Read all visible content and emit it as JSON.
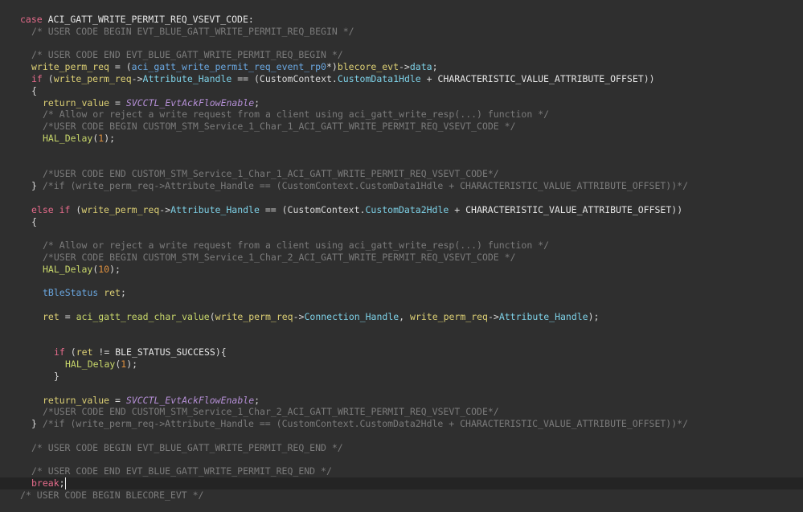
{
  "editor": {
    "lines": [
      {
        "indent": 0,
        "tokens": [
          {
            "t": "kw",
            "v": "case"
          },
          {
            "t": "macro",
            "v": " ACI_GATT_WRITE_PERMIT_REQ_VSEVT_CODE:"
          }
        ]
      },
      {
        "indent": 1,
        "tokens": [
          {
            "t": "cm",
            "v": "/* USER CODE BEGIN EVT_BLUE_GATT_WRITE_PERMIT_REQ_BEGIN */"
          }
        ]
      },
      {
        "indent": 0,
        "tokens": []
      },
      {
        "indent": 1,
        "tokens": [
          {
            "t": "cm",
            "v": "/* USER CODE END EVT_BLUE_GATT_WRITE_PERMIT_REQ_BEGIN */"
          }
        ]
      },
      {
        "indent": 1,
        "tokens": [
          {
            "t": "var",
            "v": "write_perm_req"
          },
          {
            "t": "punc",
            "v": " = ("
          },
          {
            "t": "type",
            "v": "aci_gatt_write_permit_req_event_rp0"
          },
          {
            "t": "punc",
            "v": "*)"
          },
          {
            "t": "var",
            "v": "blecore_evt"
          },
          {
            "t": "punc",
            "v": "->"
          },
          {
            "t": "field",
            "v": "data"
          },
          {
            "t": "punc",
            "v": ";"
          }
        ]
      },
      {
        "indent": 1,
        "tokens": [
          {
            "t": "kw",
            "v": "if"
          },
          {
            "t": "punc",
            "v": " ("
          },
          {
            "t": "var",
            "v": "write_perm_req"
          },
          {
            "t": "punc",
            "v": "->"
          },
          {
            "t": "field",
            "v": "Attribute_Handle"
          },
          {
            "t": "punc",
            "v": " == (CustomContext."
          },
          {
            "t": "field",
            "v": "CustomData1Hdle"
          },
          {
            "t": "punc",
            "v": " + "
          },
          {
            "t": "macro",
            "v": "CHARACTERISTIC_VALUE_ATTRIBUTE_OFFSET"
          },
          {
            "t": "punc",
            "v": "))"
          }
        ]
      },
      {
        "indent": 1,
        "tokens": [
          {
            "t": "punc",
            "v": "{"
          }
        ]
      },
      {
        "indent": 2,
        "tokens": [
          {
            "t": "var",
            "v": "return_value"
          },
          {
            "t": "punc",
            "v": " = "
          },
          {
            "t": "cst",
            "v": "SVCCTL_EvtAckFlowEnable"
          },
          {
            "t": "punc",
            "v": ";"
          }
        ]
      },
      {
        "indent": 2,
        "tokens": [
          {
            "t": "cm",
            "v": "/* Allow or reject a write request from a client using aci_gatt_write_resp(...) function */"
          }
        ]
      },
      {
        "indent": 2,
        "tokens": [
          {
            "t": "cm",
            "v": "/*USER CODE BEGIN CUSTOM_STM_Service_1_Char_1_ACI_GATT_WRITE_PERMIT_REQ_VSEVT_CODE */"
          }
        ]
      },
      {
        "indent": 2,
        "tokens": [
          {
            "t": "fn",
            "v": "HAL_Delay"
          },
          {
            "t": "punc",
            "v": "("
          },
          {
            "t": "num",
            "v": "1"
          },
          {
            "t": "punc",
            "v": ");"
          }
        ]
      },
      {
        "indent": 0,
        "tokens": []
      },
      {
        "indent": 0,
        "tokens": []
      },
      {
        "indent": 2,
        "tokens": [
          {
            "t": "cm",
            "v": "/*USER CODE END CUSTOM_STM_Service_1_Char_1_ACI_GATT_WRITE_PERMIT_REQ_VSEVT_CODE*/"
          }
        ]
      },
      {
        "indent": 1,
        "tokens": [
          {
            "t": "punc",
            "v": "} "
          },
          {
            "t": "cm",
            "v": "/*if (write_perm_req->Attribute_Handle == (CustomContext.CustomData1Hdle + CHARACTERISTIC_VALUE_ATTRIBUTE_OFFSET))*/"
          }
        ]
      },
      {
        "indent": 0,
        "tokens": []
      },
      {
        "indent": 1,
        "tokens": [
          {
            "t": "kw",
            "v": "else if"
          },
          {
            "t": "punc",
            "v": " ("
          },
          {
            "t": "var",
            "v": "write_perm_req"
          },
          {
            "t": "punc",
            "v": "->"
          },
          {
            "t": "field",
            "v": "Attribute_Handle"
          },
          {
            "t": "punc",
            "v": " == (CustomContext."
          },
          {
            "t": "field",
            "v": "CustomData2Hdle"
          },
          {
            "t": "punc",
            "v": " + "
          },
          {
            "t": "macro",
            "v": "CHARACTERISTIC_VALUE_ATTRIBUTE_OFFSET"
          },
          {
            "t": "punc",
            "v": "))"
          }
        ]
      },
      {
        "indent": 1,
        "tokens": [
          {
            "t": "punc",
            "v": "{"
          }
        ]
      },
      {
        "indent": 0,
        "tokens": []
      },
      {
        "indent": 2,
        "tokens": [
          {
            "t": "cm",
            "v": "/* Allow or reject a write request from a client using aci_gatt_write_resp(...) function */"
          }
        ]
      },
      {
        "indent": 2,
        "tokens": [
          {
            "t": "cm",
            "v": "/*USER CODE BEGIN CUSTOM_STM_Service_1_Char_2_ACI_GATT_WRITE_PERMIT_REQ_VSEVT_CODE */"
          }
        ]
      },
      {
        "indent": 2,
        "tokens": [
          {
            "t": "fn",
            "v": "HAL_Delay"
          },
          {
            "t": "punc",
            "v": "("
          },
          {
            "t": "num",
            "v": "10"
          },
          {
            "t": "punc",
            "v": ");"
          }
        ]
      },
      {
        "indent": 0,
        "tokens": []
      },
      {
        "indent": 2,
        "tokens": [
          {
            "t": "type",
            "v": "tBleStatus"
          },
          {
            "t": "punc",
            "v": " "
          },
          {
            "t": "var",
            "v": "ret"
          },
          {
            "t": "punc",
            "v": ";"
          }
        ]
      },
      {
        "indent": 0,
        "tokens": []
      },
      {
        "indent": 2,
        "tokens": [
          {
            "t": "var",
            "v": "ret"
          },
          {
            "t": "punc",
            "v": " = "
          },
          {
            "t": "fn",
            "v": "aci_gatt_read_char_value"
          },
          {
            "t": "punc",
            "v": "("
          },
          {
            "t": "var",
            "v": "write_perm_req"
          },
          {
            "t": "punc",
            "v": "->"
          },
          {
            "t": "field",
            "v": "Connection_Handle"
          },
          {
            "t": "punc",
            "v": ", "
          },
          {
            "t": "var",
            "v": "write_perm_req"
          },
          {
            "t": "punc",
            "v": "->"
          },
          {
            "t": "field",
            "v": "Attribute_Handle"
          },
          {
            "t": "punc",
            "v": ");"
          }
        ]
      },
      {
        "indent": 0,
        "tokens": []
      },
      {
        "indent": 0,
        "tokens": []
      },
      {
        "indent": 3,
        "tokens": [
          {
            "t": "kw",
            "v": "if"
          },
          {
            "t": "punc",
            "v": " ("
          },
          {
            "t": "var",
            "v": "ret"
          },
          {
            "t": "punc",
            "v": " != "
          },
          {
            "t": "macro",
            "v": "BLE_STATUS_SUCCESS"
          },
          {
            "t": "punc",
            "v": "){"
          }
        ]
      },
      {
        "indent": 4,
        "tokens": [
          {
            "t": "fn",
            "v": "HAL_Delay"
          },
          {
            "t": "punc",
            "v": "("
          },
          {
            "t": "num",
            "v": "1"
          },
          {
            "t": "punc",
            "v": ");"
          }
        ]
      },
      {
        "indent": 3,
        "tokens": [
          {
            "t": "punc",
            "v": "}"
          }
        ]
      },
      {
        "indent": 0,
        "tokens": []
      },
      {
        "indent": 2,
        "tokens": [
          {
            "t": "var",
            "v": "return_value"
          },
          {
            "t": "punc",
            "v": " = "
          },
          {
            "t": "cst",
            "v": "SVCCTL_EvtAckFlowEnable"
          },
          {
            "t": "punc",
            "v": ";"
          }
        ]
      },
      {
        "indent": 2,
        "tokens": [
          {
            "t": "cm",
            "v": "/*USER CODE END CUSTOM_STM_Service_1_Char_2_ACI_GATT_WRITE_PERMIT_REQ_VSEVT_CODE*/"
          }
        ]
      },
      {
        "indent": 1,
        "tokens": [
          {
            "t": "punc",
            "v": "} "
          },
          {
            "t": "cm",
            "v": "/*if (write_perm_req->Attribute_Handle == (CustomContext.CustomData2Hdle + CHARACTERISTIC_VALUE_ATTRIBUTE_OFFSET))*/"
          }
        ]
      },
      {
        "indent": 0,
        "tokens": []
      },
      {
        "indent": 1,
        "tokens": [
          {
            "t": "cm",
            "v": "/* USER CODE BEGIN EVT_BLUE_GATT_WRITE_PERMIT_REQ_END */"
          }
        ]
      },
      {
        "indent": 0,
        "tokens": []
      },
      {
        "indent": 1,
        "tokens": [
          {
            "t": "cm",
            "v": "/* USER CODE END EVT_BLUE_GATT_WRITE_PERMIT_REQ_END */"
          }
        ]
      },
      {
        "indent": 1,
        "current": true,
        "tokens": [
          {
            "t": "kw",
            "v": "break"
          },
          {
            "t": "punc",
            "v": ";"
          }
        ]
      },
      {
        "indent": 0,
        "tokens": [
          {
            "t": "cm",
            "v": "/* USER CODE BEGIN BLECORE_EVT */"
          }
        ]
      }
    ]
  }
}
